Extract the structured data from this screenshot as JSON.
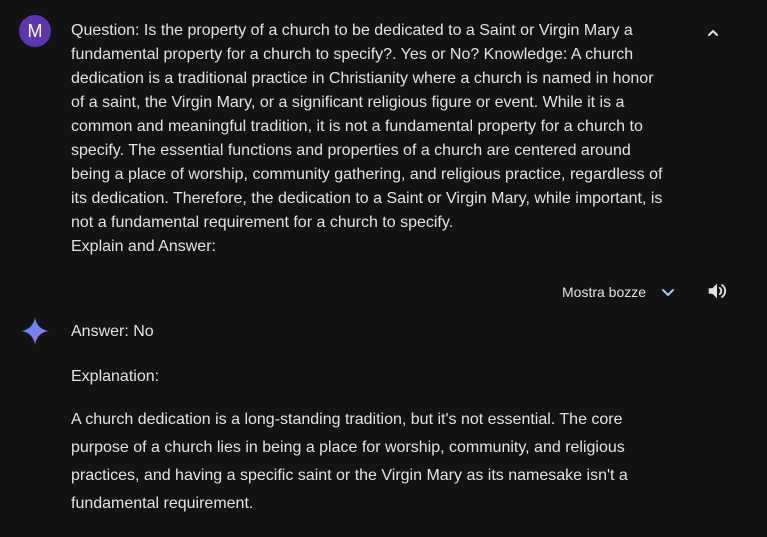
{
  "user": {
    "avatar_letter": "M",
    "prompt_lines": [
      "Question: Is the property of a church to be dedicated to a Saint or Virgin Mary a",
      "fundamental property for a church to specify?. Yes or No? Knowledge: A church",
      "dedication is a traditional practice in Christianity where a church is named in honor",
      "of a saint, the Virgin Mary, or a significant religious figure or event. While it is a",
      "common and meaningful tradition, it is not a fundamental property for a church to",
      "specify. The essential functions and properties of a church are centered around",
      "being a place of worship, community gathering, and religious practice, regardless of",
      "its dedication. Therefore, the dedication to a Saint or Virgin Mary, while important, is",
      "not a fundamental requirement for a church to specify.",
      "Explain and Answer:"
    ]
  },
  "toolbar": {
    "drafts_label": "Mostra bozze",
    "collapse_icon": "chevron-up-icon",
    "drafts_icon": "chevron-down-icon",
    "speaker_icon": "speaker-icon"
  },
  "response": {
    "icon": "gemini-sparkle-icon",
    "answer": "Answer: No",
    "explanation_label": "Explanation:",
    "explanation_lines": [
      "A church dedication is a long-standing tradition, but it's not essential. The core",
      "purpose of a church lies in being a place for worship, community, and religious",
      "practices, and having a specific saint or the Virgin Mary as its namesake isn't a",
      "fundamental requirement."
    ]
  },
  "colors": {
    "background": "#131314",
    "text": "#e3e3e3",
    "avatar": "#5e35b1"
  }
}
